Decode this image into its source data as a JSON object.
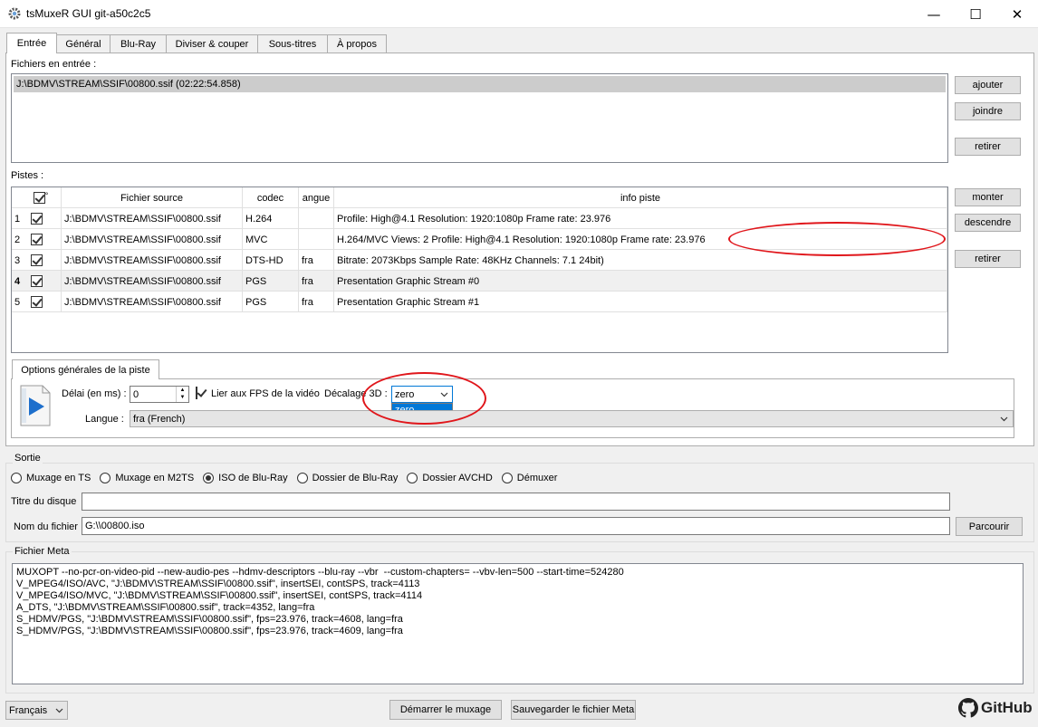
{
  "window": {
    "title": "tsMuxeR GUI git-a50c2c5",
    "minimize": "—",
    "maximize": "☐",
    "close": "✕"
  },
  "tabs": [
    "Entrée",
    "Général",
    "Blu-Ray",
    "Diviser & couper",
    "Sous-titres",
    "À propos"
  ],
  "input": {
    "label": "Fichiers en entrée :",
    "files": [
      "J:\\BDMV\\STREAM\\SSIF\\00800.ssif (02:22:54.858)"
    ],
    "add_button": "ajouter",
    "join_button": "joindre",
    "remove_button": "retirer"
  },
  "tracks": {
    "label": "Pistes :",
    "headers": {
      "check": "°",
      "source": "Fichier source",
      "codec": "codec",
      "lang": "angue",
      "info": "info piste"
    },
    "rows": [
      {
        "num": "1",
        "source": "J:\\BDMV\\STREAM\\SSIF\\00800.ssif",
        "codec": "H.264",
        "lang": "",
        "info": "Profile: High@4.1  Resolution: 1920:1080p  Frame rate: 23.976"
      },
      {
        "num": "2",
        "source": "J:\\BDMV\\STREAM\\SSIF\\00800.ssif",
        "codec": "MVC",
        "lang": "",
        "info": "H.264/MVC Views: 2 Profile: High@4.1  Resolution: 1920:1080p  Frame rate: 23.976"
      },
      {
        "num": "3",
        "source": "J:\\BDMV\\STREAM\\SSIF\\00800.ssif",
        "codec": "DTS-HD",
        "lang": "fra",
        "info": "Bitrate: 2073Kbps  Sample Rate: 48KHz  Channels: 7.1 24bit)"
      },
      {
        "num": "4",
        "source": "J:\\BDMV\\STREAM\\SSIF\\00800.ssif",
        "codec": "PGS",
        "lang": "fra",
        "info": "Presentation Graphic Stream #0"
      },
      {
        "num": "5",
        "source": "J:\\BDMV\\STREAM\\SSIF\\00800.ssif",
        "codec": "PGS",
        "lang": "fra",
        "info": "Presentation Graphic Stream #1"
      }
    ],
    "up_button": "monter",
    "down_button": "descendre",
    "remove_button": "retirer"
  },
  "track_options": {
    "tab": "Options générales de la piste",
    "delay_label": "Délai (en ms) :",
    "delay_value": "0",
    "fps_label": "Lier aux FPS de la vidéo",
    "offset_label": "Décalage 3D :",
    "offset_value": "zero",
    "offset_options": [
      "zero"
    ],
    "lang_label": "Langue :",
    "lang_value": "fra (French)"
  },
  "output": {
    "title": "Sortie",
    "modes": [
      "Muxage en TS",
      "Muxage en M2TS",
      "ISO de Blu-Ray",
      "Dossier de Blu-Ray",
      "Dossier AVCHD",
      "Démuxer"
    ],
    "selected_mode": "ISO de Blu-Ray",
    "disk_title_label": "Titre du disque",
    "disk_title_value": "",
    "filename_label": "Nom du fichier",
    "filename_value": "G:\\\\00800.iso",
    "browse_button": "Parcourir"
  },
  "meta": {
    "title": "Fichier Meta",
    "lines": [
      "MUXOPT --no-pcr-on-video-pid --new-audio-pes --hdmv-descriptors --blu-ray --vbr  --custom-chapters= --vbv-len=500 --start-time=524280",
      "V_MPEG4/ISO/AVC, \"J:\\BDMV\\STREAM\\SSIF\\00800.ssif\", insertSEI, contSPS, track=4113",
      "V_MPEG4/ISO/MVC, \"J:\\BDMV\\STREAM\\SSIF\\00800.ssif\", insertSEI, contSPS, track=4114",
      "A_DTS, \"J:\\BDMV\\STREAM\\SSIF\\00800.ssif\", track=4352, lang=fra",
      "S_HDMV/PGS, \"J:\\BDMV\\STREAM\\SSIF\\00800.ssif\", fps=23.976, track=4608, lang=fra",
      "S_HDMV/PGS, \"J:\\BDMV\\STREAM\\SSIF\\00800.ssif\", fps=23.976, track=4609, lang=fra"
    ]
  },
  "footer": {
    "language": "Français",
    "start_button": "Démarrer le muxage",
    "save_button": "Sauvegarder le fichier Meta",
    "github_label": "GitHub"
  },
  "colors": {
    "annotation": "#e0161b",
    "selection": "#0078d7"
  }
}
